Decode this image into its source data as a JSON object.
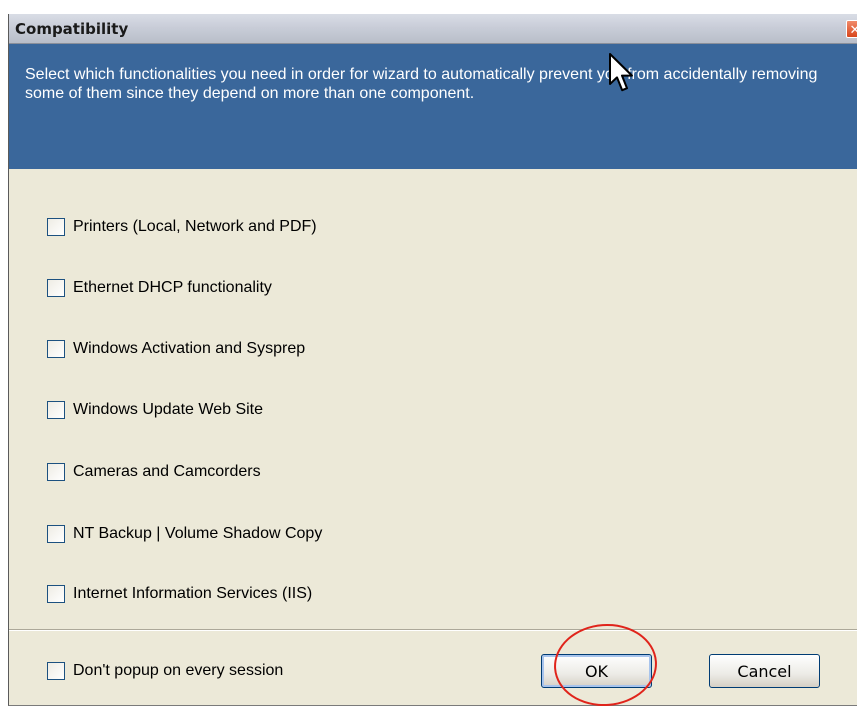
{
  "window": {
    "title": "Compatibility",
    "close_glyph": "✕"
  },
  "header": {
    "description": "Select which functionalities you need in order for wizard to automatically prevent you from accidentally removing some of them since they depend on more than one component."
  },
  "options": [
    {
      "label": "Printers (Local, Network and PDF)",
      "checked": false
    },
    {
      "label": "Ethernet DHCP functionality",
      "checked": false
    },
    {
      "label": "Windows Activation and Sysprep",
      "checked": false
    },
    {
      "label": "Windows Update Web Site",
      "checked": false
    },
    {
      "label": "Cameras and Camcorders",
      "checked": false
    },
    {
      "label": "NT Backup | Volume Shadow Copy",
      "checked": false
    },
    {
      "label": "Internet Information Services (IIS)",
      "checked": false
    }
  ],
  "footer": {
    "dont_popup_label": "Don't popup on every session",
    "dont_popup_checked": false,
    "ok_label": "OK",
    "cancel_label": "Cancel"
  },
  "colors": {
    "header_background": "#3a679b",
    "dialog_background": "#ece9d8",
    "annotation": "#e0241b",
    "close_button": "#d8461c"
  },
  "icons": {
    "close": "close-icon",
    "cursor": "mouse-pointer-icon"
  }
}
